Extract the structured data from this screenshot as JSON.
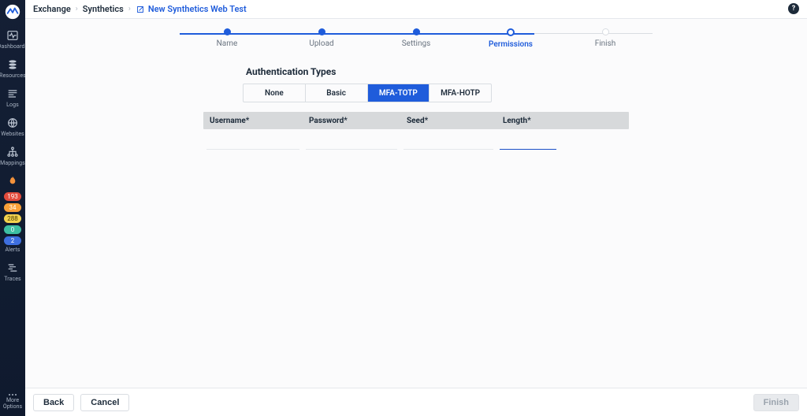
{
  "sidebar": {
    "items": [
      {
        "label": "Dashboards"
      },
      {
        "label": "Resources"
      },
      {
        "label": "Logs"
      },
      {
        "label": "Websites"
      },
      {
        "label": "Mappings"
      }
    ],
    "badges": [
      "193",
      "34",
      "288",
      "0",
      "2"
    ],
    "alerts_label": "Alerts",
    "traces_label": "Traces",
    "more_label": "More\nOptions"
  },
  "breadcrumb": {
    "root": "Exchange",
    "mid": "Synthetics",
    "current": "New Synthetics Web Test"
  },
  "stepper": {
    "steps": [
      "Name",
      "Upload",
      "Settings",
      "Permissions",
      "Finish"
    ],
    "current_index": 3
  },
  "auth": {
    "title": "Authentication Types",
    "tabs": [
      "None",
      "Basic",
      "MFA-TOTP",
      "MFA-HOTP"
    ],
    "active_index": 2,
    "columns": [
      "Username*",
      "Password*",
      "Seed*",
      "Length*"
    ],
    "length_value": ""
  },
  "footer": {
    "back": "Back",
    "cancel": "Cancel",
    "finish": "Finish"
  },
  "help_tooltip": "?"
}
